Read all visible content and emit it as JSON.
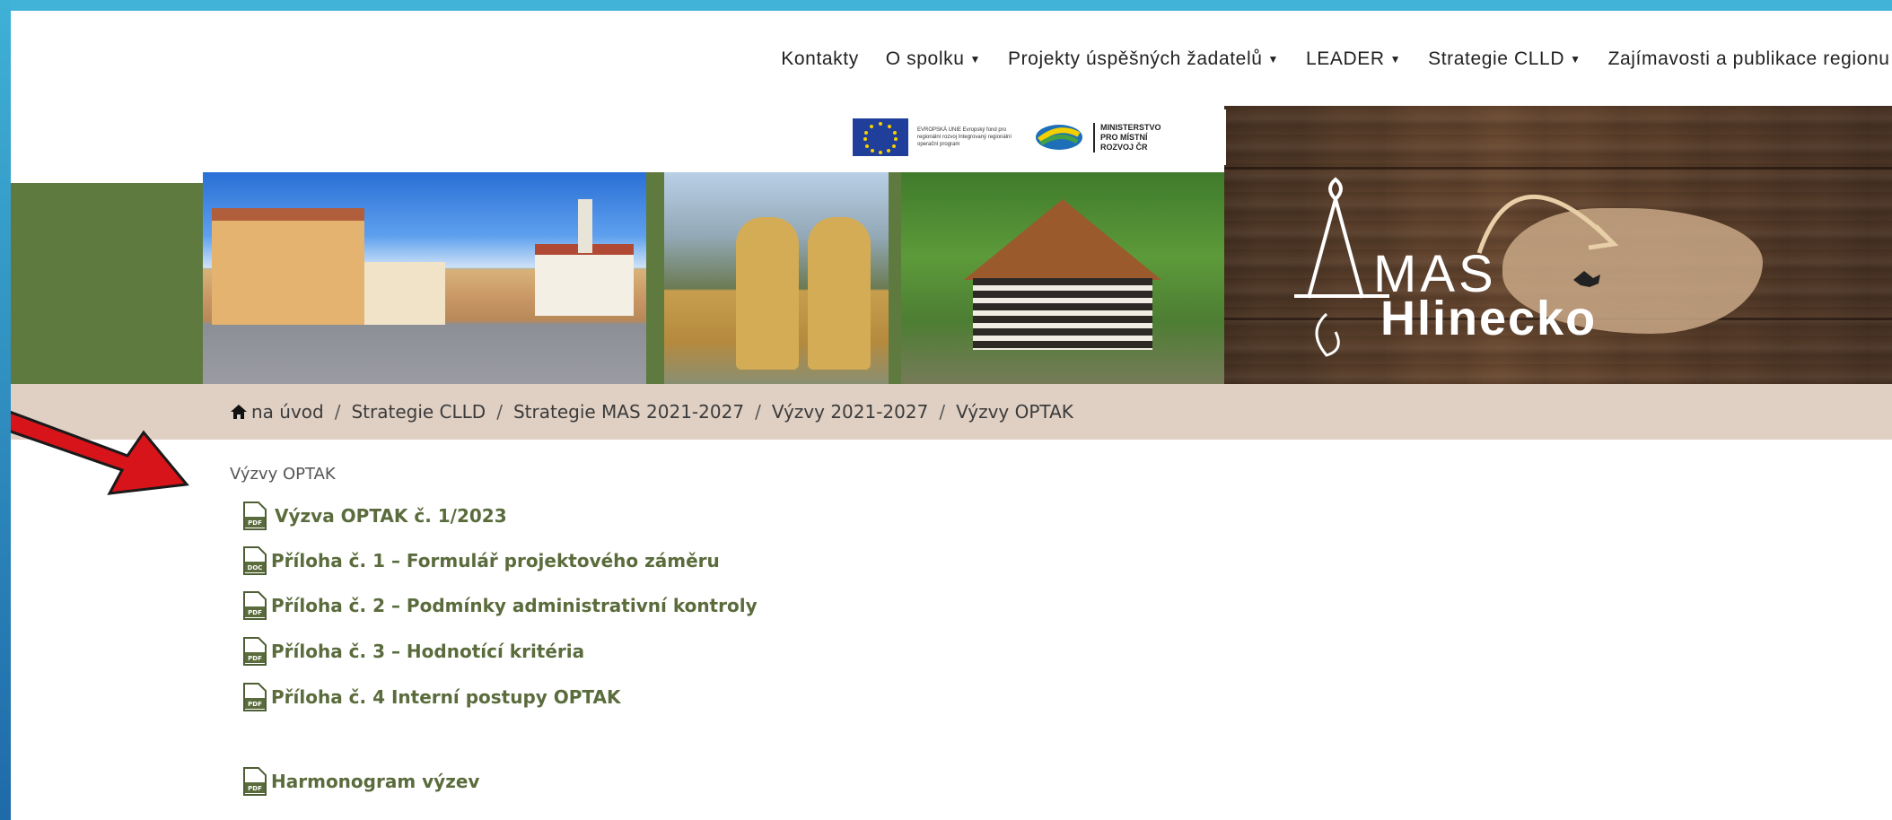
{
  "nav": {
    "items": [
      {
        "label": "Kontakty",
        "dropdown": false
      },
      {
        "label": "O spolku",
        "dropdown": true
      },
      {
        "label": "Projekty úspěšných žadatelů",
        "dropdown": true
      },
      {
        "label": "LEADER",
        "dropdown": true
      },
      {
        "label": "Strategie CLLD",
        "dropdown": true
      },
      {
        "label": "Zajímavosti a publikace regionu",
        "dropdown": true
      }
    ]
  },
  "header": {
    "eu_logo_text": "EVROPSKÁ UNIE Evropský fond pro regionální rozvoj Integrovaný regionální operační program",
    "mmr_logo_text": "MINISTERSTVO PRO MÍSTNÍ ROZVOJ ČR",
    "logo_mas": "MAS",
    "logo_name": "Hlinecko"
  },
  "breadcrumb": {
    "items": [
      "na úvod",
      "Strategie CLLD",
      "Strategie MAS 2021-2027",
      "Výzvy 2021-2027",
      "Výzvy OPTAK"
    ],
    "separator": "/"
  },
  "content": {
    "title": "Výzvy OPTAK",
    "documents": [
      {
        "label": "Výzva OPTAK č. 1/2023",
        "type": "PDF"
      },
      {
        "label": "Příloha č. 1 – Formulář projektového záměru",
        "type": "DOC"
      },
      {
        "label": "Příloha č. 2 – Podmínky administrativní kontroly",
        "type": "PDF"
      },
      {
        "label": "Příloha č. 3 – Hodnotící kritéria",
        "type": "PDF"
      },
      {
        "label": "Příloha č. 4 Interní postupy OPTAK",
        "type": "PDF"
      },
      {
        "label": "Harmonogram výzev",
        "type": "PDF"
      }
    ]
  },
  "colors": {
    "frame": "#2f89c4",
    "green": "#5e7a3f",
    "breadcrumb_bg": "#e0d0c4",
    "link": "#5a6b3c",
    "arrow": "#d7141a"
  },
  "icons": {
    "home": "home-icon",
    "pdf": "pdf-file-icon",
    "doc": "doc-file-icon",
    "caret": "caret-down-icon",
    "arrow": "red-arrow-annotation"
  }
}
